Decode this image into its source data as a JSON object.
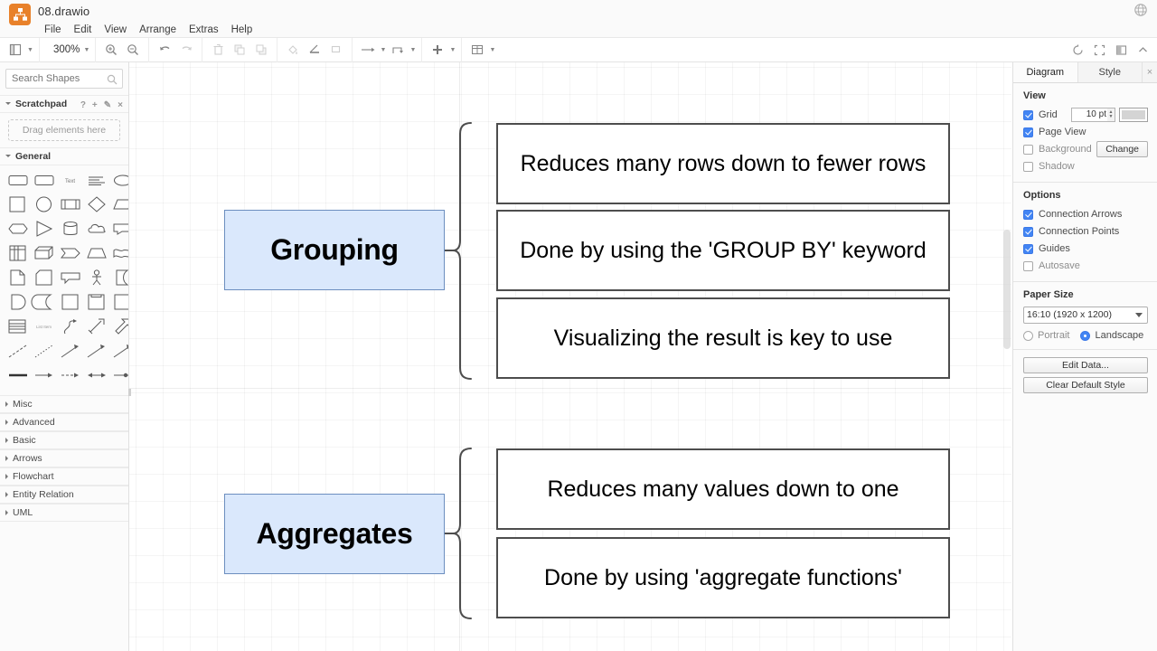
{
  "titlebar": {
    "document_title": "08.drawio",
    "menus": [
      "File",
      "Edit",
      "View",
      "Arrange",
      "Extras",
      "Help"
    ],
    "globe_icon": "globe-icon",
    "app_icon": "drawio-logo-icon"
  },
  "toolbar": {
    "view_icon": "page-view-icon",
    "zoom_level": "300%",
    "buttons": [
      "zoom-in-icon",
      "zoom-out-icon",
      "undo-icon",
      "redo-icon",
      "delete-icon",
      "to-front-icon",
      "to-back-icon",
      "fill-color-icon",
      "line-color-icon",
      "shadow-icon",
      "connection-icon",
      "waypoints-icon",
      "insert-icon",
      "table-icon"
    ],
    "right_buttons": [
      "format-panel-icon",
      "fullscreen-icon",
      "outline-icon",
      "collapse-icon"
    ]
  },
  "left_panel": {
    "search": {
      "placeholder": "Search Shapes",
      "value": "",
      "icon": "search-icon"
    },
    "scratchpad": {
      "label": "Scratchpad",
      "drop_hint": "Drag elements here",
      "tools": [
        "?",
        "+",
        "✎",
        "×"
      ]
    },
    "general_label": "General",
    "sections": [
      "Misc",
      "Advanced",
      "Basic",
      "Arrows",
      "Flowchart",
      "Entity Relation",
      "UML"
    ]
  },
  "right_panel": {
    "tabs": [
      {
        "label": "Diagram",
        "active": true
      },
      {
        "label": "Style",
        "active": false
      }
    ],
    "close_label": "×",
    "view": {
      "title": "View",
      "grid": {
        "label": "Grid",
        "checked": true,
        "size": "10 pt",
        "color": "#d4d4d4"
      },
      "page_view": {
        "label": "Page View",
        "checked": true
      },
      "background": {
        "label": "Background",
        "checked": false,
        "change_label": "Change"
      },
      "shadow": {
        "label": "Shadow",
        "checked": false
      }
    },
    "options": {
      "title": "Options",
      "items": [
        {
          "label": "Connection Arrows",
          "checked": true
        },
        {
          "label": "Connection Points",
          "checked": true
        },
        {
          "label": "Guides",
          "checked": true
        },
        {
          "label": "Autosave",
          "checked": false
        }
      ]
    },
    "paper": {
      "title": "Paper Size",
      "selected": "16:10 (1920 x 1200)",
      "orientation": [
        {
          "label": "Portrait",
          "selected": false
        },
        {
          "label": "Landscape",
          "selected": true
        }
      ]
    },
    "actions": [
      "Edit Data...",
      "Clear Default Style"
    ]
  },
  "canvas": {
    "zoom": "300%",
    "nodes": [
      {
        "id": "grouping",
        "label": "Grouping",
        "type": "topic",
        "fill": "#dae8fc",
        "stroke": "#6c8ebf"
      },
      {
        "id": "aggregates",
        "label": "Aggregates",
        "type": "topic",
        "fill": "#dae8fc",
        "stroke": "#6c8ebf"
      }
    ],
    "grouping_items": [
      "Reduces many rows down to fewer rows",
      "Done by using the 'GROUP BY' keyword",
      "Visualizing the result is key to use"
    ],
    "aggregates_items": [
      "Reduces many values down to one",
      "Done by using 'aggregate functions'"
    ]
  }
}
